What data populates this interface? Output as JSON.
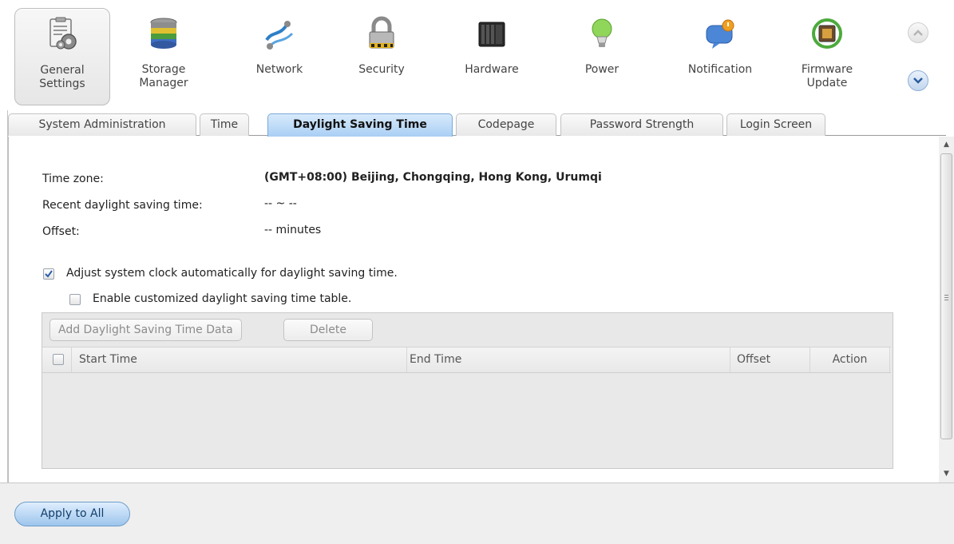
{
  "top_nav": {
    "items": [
      {
        "label": "General\nSettings",
        "icon": "general-settings-icon",
        "active": true
      },
      {
        "label": "Storage\nManager",
        "icon": "storage-manager-icon"
      },
      {
        "label": "Network",
        "icon": "network-icon"
      },
      {
        "label": "Security",
        "icon": "lock-icon"
      },
      {
        "label": "Hardware",
        "icon": "hardware-icon"
      },
      {
        "label": "Power",
        "icon": "lightbulb-icon"
      },
      {
        "label": "Notification",
        "icon": "notification-bubble-icon"
      },
      {
        "label": "Firmware\nUpdate",
        "icon": "firmware-chip-icon"
      }
    ],
    "scroll_up_icon": "chevron-up-icon",
    "scroll_down_icon": "chevron-down-icon"
  },
  "tabs": [
    {
      "label": "System Administration"
    },
    {
      "label": "Time"
    },
    {
      "label": "Daylight Saving Time",
      "active": true
    },
    {
      "label": "Codepage"
    },
    {
      "label": "Password Strength"
    },
    {
      "label": "Login Screen"
    }
  ],
  "dst": {
    "time_zone_label": "Time zone:",
    "time_zone_value": "(GMT+08:00) Beijing, Chongqing, Hong Kong, Urumqi",
    "recent_label": "Recent daylight saving time:",
    "recent_value": "-- ~ --",
    "offset_label": "Offset:",
    "offset_value": "-- minutes",
    "auto_adjust_label": "Adjust system clock automatically for daylight saving time.",
    "auto_adjust_checked": true,
    "custom_table_label": "Enable customized daylight saving time table.",
    "custom_table_checked": false
  },
  "grid": {
    "add_button": "Add Daylight Saving Time Data",
    "delete_button": "Delete",
    "columns": [
      "Start Time",
      "End Time",
      "Offset",
      "Action"
    ],
    "rows": []
  },
  "footer": {
    "apply_button": "Apply to All"
  },
  "colors": {
    "active_tab": "#a9cff4",
    "apply_button": "#9dc5ec"
  }
}
